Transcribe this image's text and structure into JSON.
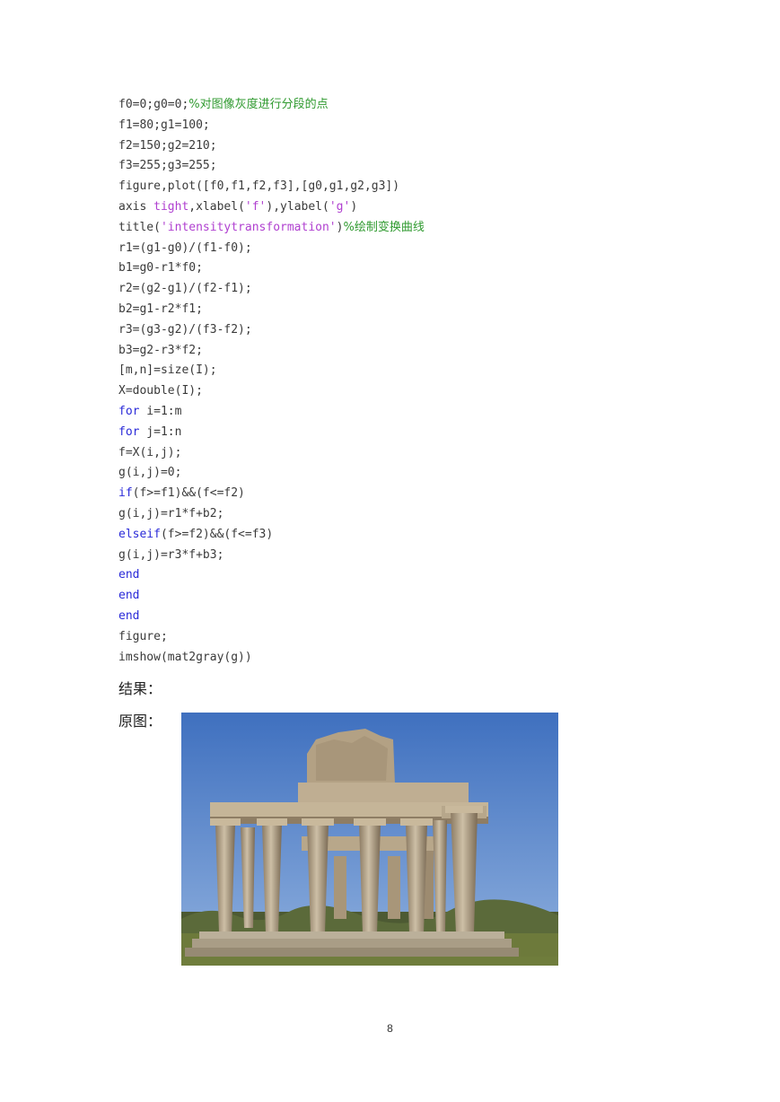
{
  "code_lines": [
    [
      {
        "t": "f0=0;g0=0;",
        "c": "p"
      },
      {
        "t": "%对图像灰度进行分段的点",
        "c": "c"
      }
    ],
    [
      {
        "t": "f1=80;g1=100;",
        "c": "p"
      }
    ],
    [
      {
        "t": "f2=150;g2=210;",
        "c": "p"
      }
    ],
    [
      {
        "t": "f3=255;g3=255;",
        "c": "p"
      }
    ],
    [
      {
        "t": "figure,plot([f0,f1,f2,f3],[g0,g1,g2,g3])",
        "c": "p"
      }
    ],
    [
      {
        "t": "axis ",
        "c": "p"
      },
      {
        "t": "tight",
        "c": "s"
      },
      {
        "t": ",xlabel(",
        "c": "p"
      },
      {
        "t": "'f'",
        "c": "s"
      },
      {
        "t": "),ylabel(",
        "c": "p"
      },
      {
        "t": "'g'",
        "c": "s"
      },
      {
        "t": ")",
        "c": "p"
      }
    ],
    [
      {
        "t": "title(",
        "c": "p"
      },
      {
        "t": "'intensitytransformation'",
        "c": "s"
      },
      {
        "t": ")",
        "c": "p"
      },
      {
        "t": "%绘制变换曲线",
        "c": "c"
      }
    ],
    [
      {
        "t": "r1=(g1-g0)/(f1-f0);",
        "c": "p"
      }
    ],
    [
      {
        "t": "b1=g0-r1*f0;",
        "c": "p"
      }
    ],
    [
      {
        "t": "r2=(g2-g1)/(f2-f1);",
        "c": "p"
      }
    ],
    [
      {
        "t": "b2=g1-r2*f1;",
        "c": "p"
      }
    ],
    [
      {
        "t": "r3=(g3-g2)/(f3-f2);",
        "c": "p"
      }
    ],
    [
      {
        "t": "b3=g2-r3*f2;",
        "c": "p"
      }
    ],
    [
      {
        "t": "[m,n]=size(I);",
        "c": "p"
      }
    ],
    [
      {
        "t": "X=double(I);",
        "c": "p"
      }
    ],
    [
      {
        "t": "for",
        "c": "k"
      },
      {
        "t": " i=1:m",
        "c": "p"
      }
    ],
    [
      {
        "t": "for",
        "c": "k"
      },
      {
        "t": " j=1:n",
        "c": "p"
      }
    ],
    [
      {
        "t": "f=X(i,j);",
        "c": "p"
      }
    ],
    [
      {
        "t": "g(i,j)=0;",
        "c": "p"
      }
    ],
    [
      {
        "t": "if",
        "c": "k"
      },
      {
        "t": "(f>=f1)&&(f<=f2)",
        "c": "p"
      }
    ],
    [
      {
        "t": "g(i,j)=r1*f+b2;",
        "c": "p"
      }
    ],
    [
      {
        "t": "elseif",
        "c": "k"
      },
      {
        "t": "(f>=f2)&&(f<=f3)",
        "c": "p"
      }
    ],
    [
      {
        "t": "g(i,j)=r3*f+b3;",
        "c": "p"
      }
    ],
    [
      {
        "t": "end",
        "c": "k"
      }
    ],
    [
      {
        "t": "end",
        "c": "k"
      }
    ],
    [
      {
        "t": "end",
        "c": "k"
      }
    ],
    [
      {
        "t": "figure;",
        "c": "p"
      }
    ],
    [
      {
        "t": "imshow(mat2gray(g))",
        "c": "p"
      }
    ]
  ],
  "result_label": "结果：",
  "original_label": "原图：",
  "photo_icon": "greek-temple-photo",
  "page_number": "8",
  "colors": {
    "keyword": "#2a2ad8",
    "string": "#b040d0",
    "comment": "#2f9a2f",
    "plain": "#3a3a3a",
    "sky": "#4f7fc7",
    "stone": "#b9a78d"
  }
}
